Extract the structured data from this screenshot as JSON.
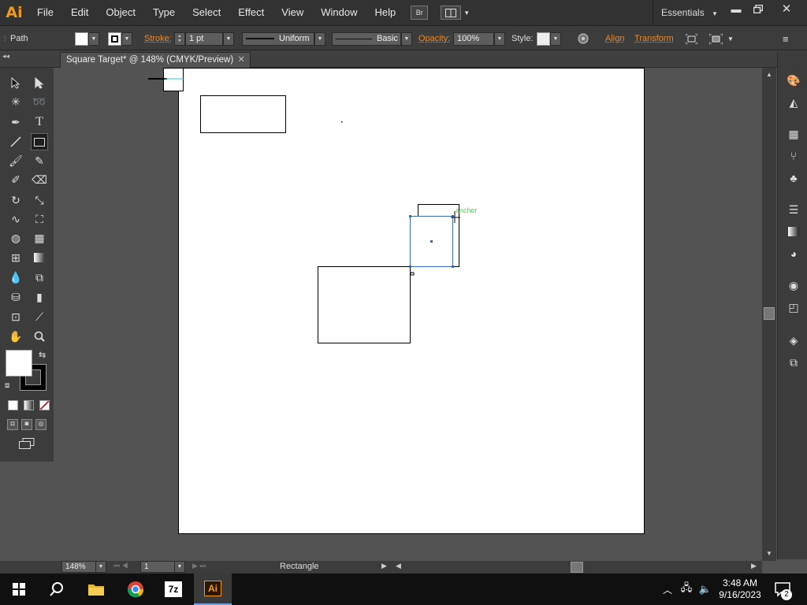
{
  "app": {
    "logo": "Ai"
  },
  "menu": [
    "File",
    "Edit",
    "Object",
    "Type",
    "Select",
    "Effect",
    "View",
    "Window",
    "Help"
  ],
  "menubar": {
    "bridge_label": "Br",
    "workspace": "Essentials"
  },
  "control": {
    "selection_type": "Path",
    "stroke_label": "Stroke:",
    "stroke_weight": "1 pt",
    "profile": "Uniform",
    "brush": "Basic",
    "opacity_label": "Opacity:",
    "opacity_value": "100%",
    "style_label": "Style:",
    "align_label": "Align",
    "transform_label": "Transform"
  },
  "document": {
    "tab_title": "Square Target* @ 148% (CMYK/Preview)"
  },
  "canvas": {
    "smart_guide_label": "anchor"
  },
  "status": {
    "zoom": "148%",
    "artboard_number": "1",
    "current_tool": "Rectangle"
  },
  "taskbar": {
    "apps": [
      "start",
      "search",
      "file-explorer",
      "chrome",
      "7zip",
      "illustrator"
    ],
    "time": "3:48 AM",
    "date": "9/16/2023",
    "notifications": "2"
  },
  "colors": {
    "accent_orange": "#e8892e",
    "selection_blue": "#3a6bc4",
    "smart_guide_green": "#3ddc3d"
  }
}
